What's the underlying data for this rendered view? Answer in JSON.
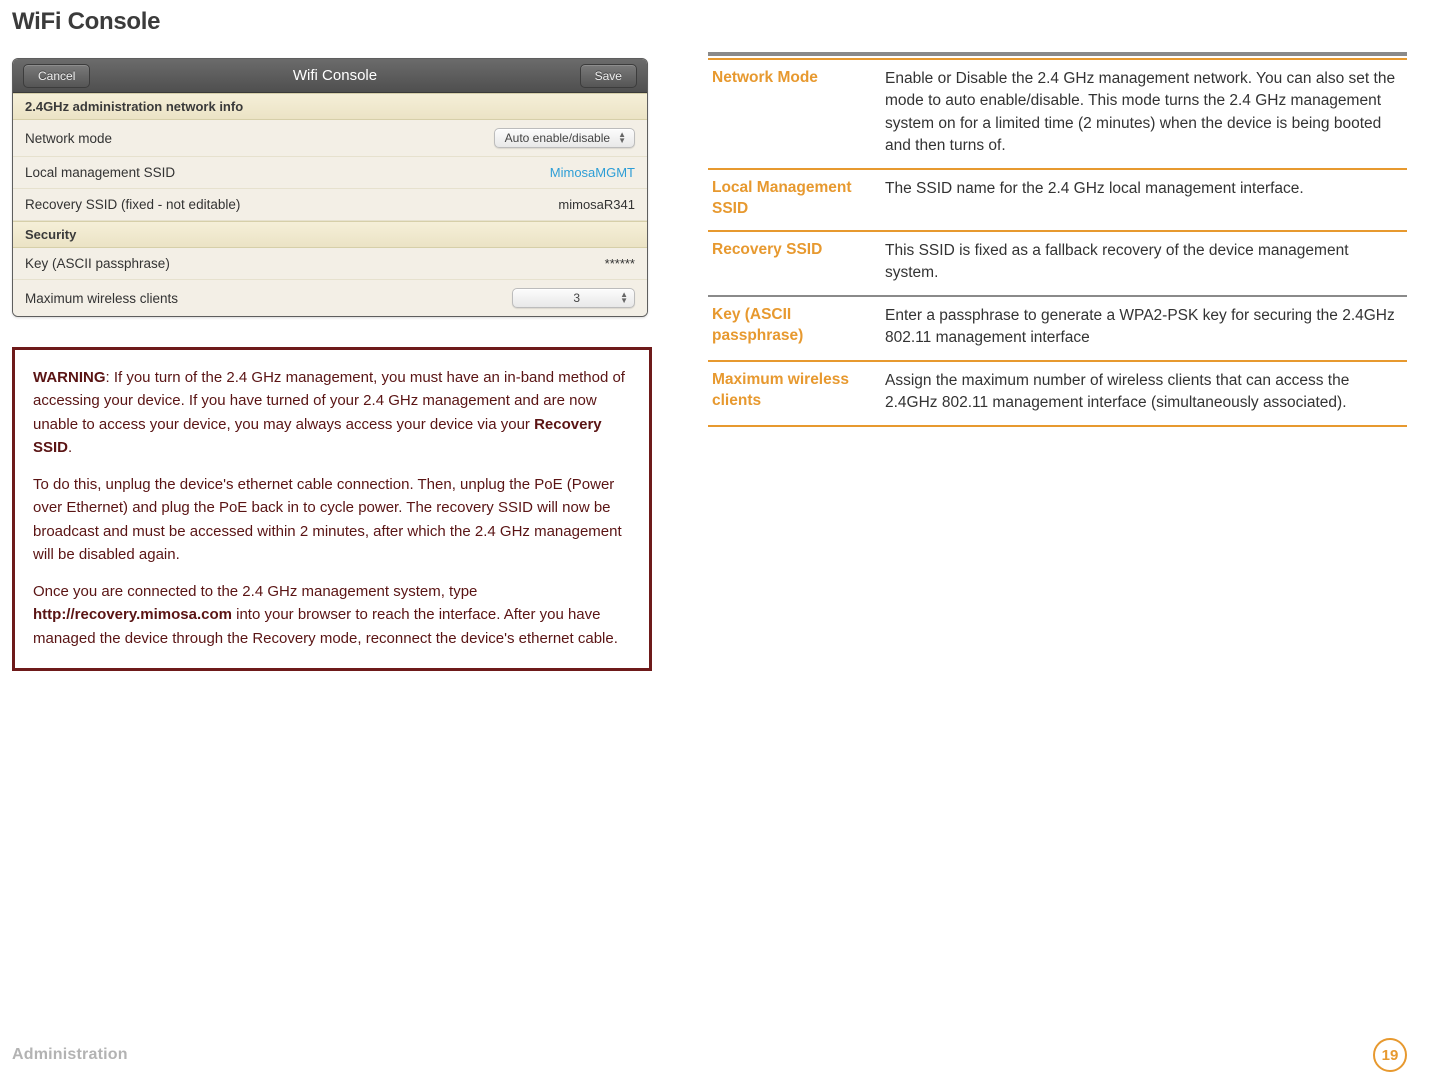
{
  "page_title": "WiFi Console",
  "panel": {
    "title": "Wifi Console",
    "cancel_label": "Cancel",
    "save_label": "Save",
    "section1_title": "2.4GHz administration network info",
    "rows1": {
      "network_mode_label": "Network mode",
      "network_mode_value": "Auto enable/disable",
      "ssid_label": "Local management SSID",
      "ssid_value": "MimosaMGMT",
      "recovery_label": "Recovery SSID (fixed - not editable)",
      "recovery_value": "mimosaR341"
    },
    "section2_title": "Security",
    "rows2": {
      "key_label": "Key (ASCII passphrase)",
      "key_value": "******",
      "max_label": "Maximum wireless clients",
      "max_value": "3"
    }
  },
  "warning": {
    "bold1": "WARNING",
    "p1_rest": ": If you turn of the 2.4 GHz management, you must have an in-band method of accessing your device. If you have turned of your 2.4 GHz management and are now unable to access your device, you may always access your device via your ",
    "bold1b": "Recovery SSID",
    "p1_tail": ".",
    "p2": "To do this, unplug the device's ethernet cable connection. Then, unplug the PoE (Power over Ethernet) and plug the PoE back in to cycle power. The recovery SSID will now be broadcast and must be accessed within 2 minutes, after which the 2.4 GHz management will be disabled again.",
    "p3a": "Once you are connected to the 2.4 GHz management system, type ",
    "p3_bold": "http://recovery.mimosa.com",
    "p3b": " into your browser to reach the interface. After you have managed the device through the Recovery mode, reconnect the device's ethernet cable."
  },
  "defs": [
    {
      "term": "Network Mode",
      "desc": "Enable or Disable the 2.4 GHz management network. You can also set the mode to auto enable/disable. This mode turns the 2.4 GHz management system on for a limited time (2 minutes) when the device is being booted and then turns of."
    },
    {
      "term": "Local Management SSID",
      "desc": "The SSID name for the 2.4 GHz local management interface."
    },
    {
      "term": "Recovery SSID",
      "desc": "This SSID is fixed as a fallback recovery of the device management system."
    },
    {
      "term": "Key (ASCII passphrase)",
      "desc": "Enter a passphrase to generate a WPA2-PSK key for securing the 2.4GHz 802.11 management interface"
    },
    {
      "term": "Maximum wireless clients",
      "desc": "Assign the maximum number of wireless clients that can access the 2.4GHz 802.11 management interface (simultaneously associated)."
    }
  ],
  "footer": {
    "section": "Administration",
    "page": "19"
  }
}
